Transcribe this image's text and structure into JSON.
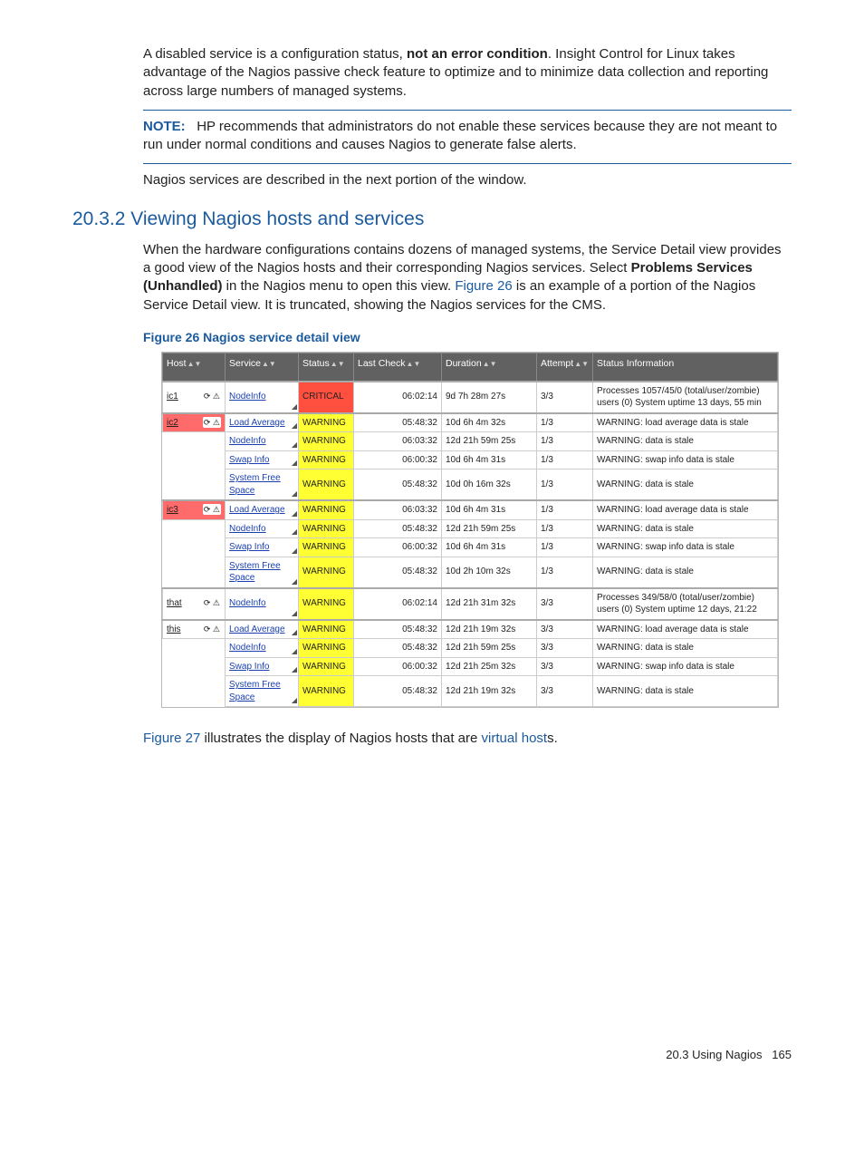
{
  "para1": {
    "a": "A disabled service is a configuration status, ",
    "b": "not an error condition",
    "c": ". Insight Control for Linux takes advantage of the Nagios passive check feature to optimize and to minimize data collection and reporting across large numbers of managed systems."
  },
  "note": {
    "label": "NOTE:",
    "text": "HP recommends that administrators do not enable these services because they are not meant to run under normal conditions and causes Nagios to generate false alerts."
  },
  "para2": "Nagios services are described in the next portion of the window.",
  "section_num": "20.3.2",
  "section_title": "Viewing Nagios hosts and services",
  "para3": {
    "a": "When the hardware configurations contains dozens of managed systems, the Service Detail view provides a good view of the Nagios hosts and their corresponding Nagios services. Select ",
    "b": "Problems Services (Unhandled)",
    "c": " in the Nagios menu to open this view. ",
    "d": "Figure 26",
    "e": " is an example of a portion of the Nagios Service Detail view. It is truncated, showing the Nagios services for the CMS."
  },
  "fig26": "Figure 26 Nagios service detail view",
  "headers": {
    "host": "Host",
    "service": "Service",
    "status": "Status",
    "last": "Last Check",
    "duration": "Duration",
    "attempt": "Attempt",
    "info": "Status Information"
  },
  "icons": "⟳ ⚠",
  "rows": [
    {
      "host": "ic1",
      "hostClass": "",
      "serv": "NodeInfo",
      "stat": "CRITICAL",
      "statClass": "stat-critical",
      "last": "06:02:14",
      "dur": "9d 7h 28m 27s",
      "att": "3/3",
      "info": "Processes 1057/45/0 (total/user/zombie) users (0) System uptime 13 days, 55 min",
      "gap": true
    },
    {
      "host": "ic2",
      "hostClass": "host-red",
      "serv": "Load Average",
      "stat": "WARNING",
      "statClass": "stat-warning",
      "last": "05:48:32",
      "dur": "10d 6h 4m 32s",
      "att": "1/3",
      "info": "WARNING: load average data is stale",
      "gap": true
    },
    {
      "host": "",
      "serv": "NodeInfo",
      "stat": "WARNING",
      "statClass": "stat-warning",
      "last": "06:03:32",
      "dur": "12d 21h 59m 25s",
      "att": "1/3",
      "info": "WARNING: data is stale"
    },
    {
      "host": "",
      "serv": "Swap Info",
      "stat": "WARNING",
      "statClass": "stat-warning",
      "last": "06:00:32",
      "dur": "10d 6h 4m 31s",
      "att": "1/3",
      "info": "WARNING: swap info data is stale"
    },
    {
      "host": "",
      "serv": "System Free Space",
      "stat": "WARNING",
      "statClass": "stat-warning",
      "last": "05:48:32",
      "dur": "10d 0h 16m 32s",
      "att": "1/3",
      "info": "WARNING: data is stale"
    },
    {
      "host": "ic3",
      "hostClass": "host-red",
      "serv": "Load Average",
      "stat": "WARNING",
      "statClass": "stat-warning",
      "last": "06:03:32",
      "dur": "10d 6h 4m 31s",
      "att": "1/3",
      "info": "WARNING: load average data is stale",
      "gap": true
    },
    {
      "host": "",
      "serv": "NodeInfo",
      "stat": "WARNING",
      "statClass": "stat-warning",
      "last": "05:48:32",
      "dur": "12d 21h 59m 25s",
      "att": "1/3",
      "info": "WARNING: data is stale"
    },
    {
      "host": "",
      "serv": "Swap Info",
      "stat": "WARNING",
      "statClass": "stat-warning",
      "last": "06:00:32",
      "dur": "10d 6h 4m 31s",
      "att": "1/3",
      "info": "WARNING: swap info data is stale"
    },
    {
      "host": "",
      "serv": "System Free Space",
      "stat": "WARNING",
      "statClass": "stat-warning",
      "last": "05:48:32",
      "dur": "10d 2h 10m 32s",
      "att": "1/3",
      "info": "WARNING: data is stale"
    },
    {
      "host": "that",
      "hostClass": "",
      "serv": "NodeInfo",
      "stat": "WARNING",
      "statClass": "stat-warning",
      "last": "06:02:14",
      "dur": "12d 21h 31m 32s",
      "att": "3/3",
      "info": "Processes 349/58/0 (total/user/zombie) users (0) System uptime 12 days, 21:22",
      "gap": true
    },
    {
      "host": "this",
      "hostClass": "",
      "serv": "Load Average",
      "stat": "WARNING",
      "statClass": "stat-warning",
      "last": "05:48:32",
      "dur": "12d 21h 19m 32s",
      "att": "3/3",
      "info": "WARNING: load average data is stale",
      "gap": true
    },
    {
      "host": "",
      "serv": "NodeInfo",
      "stat": "WARNING",
      "statClass": "stat-warning",
      "last": "05:48:32",
      "dur": "12d 21h 59m 25s",
      "att": "3/3",
      "info": "WARNING: data is stale"
    },
    {
      "host": "",
      "serv": "Swap Info",
      "stat": "WARNING",
      "statClass": "stat-warning",
      "last": "06:00:32",
      "dur": "12d 21h 25m 32s",
      "att": "3/3",
      "info": "WARNING: swap info data is stale"
    },
    {
      "host": "",
      "serv": "System Free Space",
      "stat": "WARNING",
      "statClass": "stat-warning",
      "last": "05:48:32",
      "dur": "12d 21h 19m 32s",
      "att": "3/3",
      "info": "WARNING: data is stale"
    }
  ],
  "para4": {
    "a": "Figure 27",
    "b": " illustrates the display of Nagios hosts that are ",
    "c": "virtual host",
    "d": "s."
  },
  "footer": {
    "section": "20.3 Using Nagios",
    "page": "165"
  }
}
